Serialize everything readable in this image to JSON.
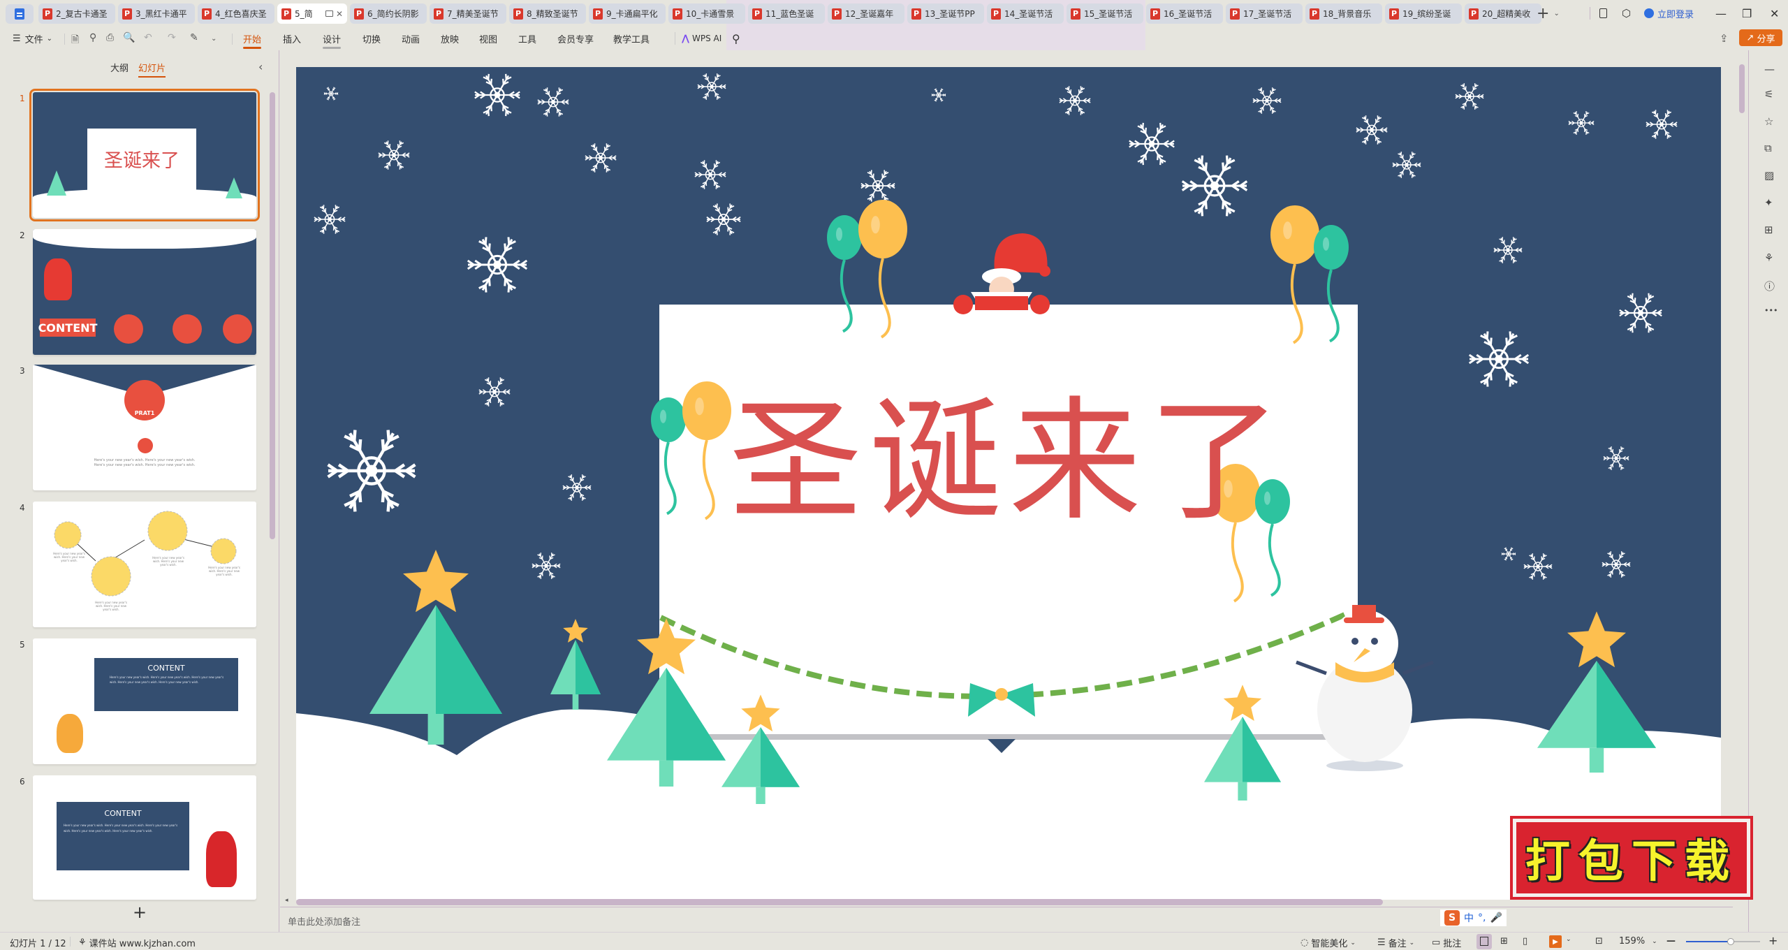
{
  "app": {
    "tabs": [
      {
        "label": "2_复古卡通圣"
      },
      {
        "label": "3_黑红卡通平"
      },
      {
        "label": "4_红色喜庆圣"
      },
      {
        "label": "5_简",
        "active": true
      },
      {
        "label": "6_简约长阴影"
      },
      {
        "label": "7_精美圣诞节"
      },
      {
        "label": "8_精致圣诞节"
      },
      {
        "label": "9_卡通扁平化"
      },
      {
        "label": "10_卡通雪景"
      },
      {
        "label": "11_蓝色圣诞"
      },
      {
        "label": "12_圣诞嘉年"
      },
      {
        "label": "13_圣诞节PP"
      },
      {
        "label": "14_圣诞节活"
      },
      {
        "label": "15_圣诞节活"
      },
      {
        "label": "16_圣诞节活"
      },
      {
        "label": "17_圣诞节活"
      },
      {
        "label": "18_背景音乐"
      },
      {
        "label": "19_缤纷圣诞"
      },
      {
        "label": "20_超精美收"
      }
    ],
    "tab_icon_letter": "P",
    "new_tab": "+",
    "login_label": "立即登录",
    "window_controls": {
      "minimize": "—",
      "restore": "❐",
      "close": "✕"
    }
  },
  "ribbon": {
    "file_menu": "文件",
    "menu_items": [
      "开始",
      "插入",
      "设计",
      "切换",
      "动画",
      "放映",
      "视图",
      "工具",
      "会员专享",
      "教学工具"
    ],
    "active_item": "开始",
    "wps_ai": "WPS AI",
    "share": "分享"
  },
  "left_panel": {
    "tab_outline": "大纲",
    "tab_slides": "幻灯片",
    "active_tab": "幻灯片",
    "slides": [
      {
        "num": "1",
        "title": "圣诞来了",
        "selected": true
      },
      {
        "num": "2",
        "title": "CONTENT"
      },
      {
        "num": "3",
        "title": "PRAT1",
        "body": "Here's your new year's wish. Here's your new year's wish. Here's your new year's wish. Here's your new year's wish."
      },
      {
        "num": "4",
        "captions": [
          "Here's your new year's wish. Here's your new year's wish.",
          "Here's your new year's wish. Here's your new year's wish.",
          "Here's your new year's wish. Here's your new year's wish.",
          "Here's your new year's wish. Here's your new year's wish."
        ]
      },
      {
        "num": "5",
        "title": "CONTENT",
        "body": "Here's your new year's wish. Here's your new year's wish. Here's your new year's wish. Here's your new year's wish. Here's your new year's wish."
      },
      {
        "num": "6",
        "title": "CONTENT",
        "body": "Here's your new year's wish. Here's your new year's wish. Here's your new year's wish. Here's your new year's wish. Here's your new year's wish."
      }
    ],
    "add_slide": "+"
  },
  "slide": {
    "title": "圣诞来了",
    "colors": {
      "background": "#344e70",
      "title": "#d9504f",
      "tree_light": "#6fdeb9",
      "tree_dark": "#2dc39f",
      "star": "#fdbf4f",
      "balloon_yellow": "#fdbf4f",
      "balloon_green": "#2dc39f",
      "garland": "#6fb04a"
    }
  },
  "notes": {
    "placeholder": "单击此处添加备注"
  },
  "statusbar": {
    "slide_indicator": "幻灯片 1 / 12",
    "site": "课件站 www.kjzhan.com",
    "smart_beautify": "智能美化",
    "notes": "备注",
    "comments": "批注",
    "zoom": "159%",
    "zoom_level_fraction": 0.6
  },
  "ime": {
    "logo": "S",
    "mode": "中",
    "punct": "°,"
  },
  "download_badge": "打包下载",
  "right_sidebar": {
    "icons": [
      "collapse-icon",
      "adjust-icon",
      "star-animation-icon",
      "slide-switch-icon",
      "image-icon",
      "magic-wand-icon",
      "book-search-icon",
      "shirt-icon",
      "help-icon",
      "more-icon"
    ]
  }
}
